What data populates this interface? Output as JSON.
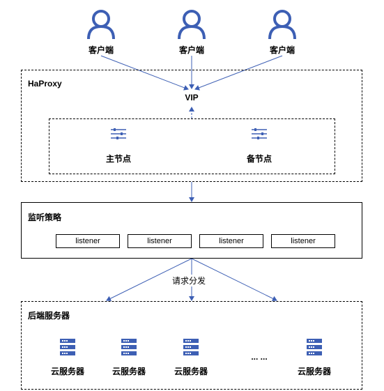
{
  "clients": [
    {
      "label": "客户端"
    },
    {
      "label": "客户端"
    },
    {
      "label": "客户端"
    }
  ],
  "haproxy": {
    "title": "HaProxy",
    "vip": "VIP",
    "master": "主节点",
    "backup": "备节点"
  },
  "policy": {
    "title": "监听策略",
    "listeners": [
      "listener",
      "listener",
      "listener",
      "listener"
    ]
  },
  "dispatch_label": "请求分发",
  "backend": {
    "title": "后端服务器",
    "servers": [
      "云服务器",
      "云服务器",
      "云服务器",
      "云服务器"
    ],
    "ellipsis": "... ..."
  },
  "colors": {
    "accent": "#3d5fb4",
    "line": "#3d5fb4"
  }
}
